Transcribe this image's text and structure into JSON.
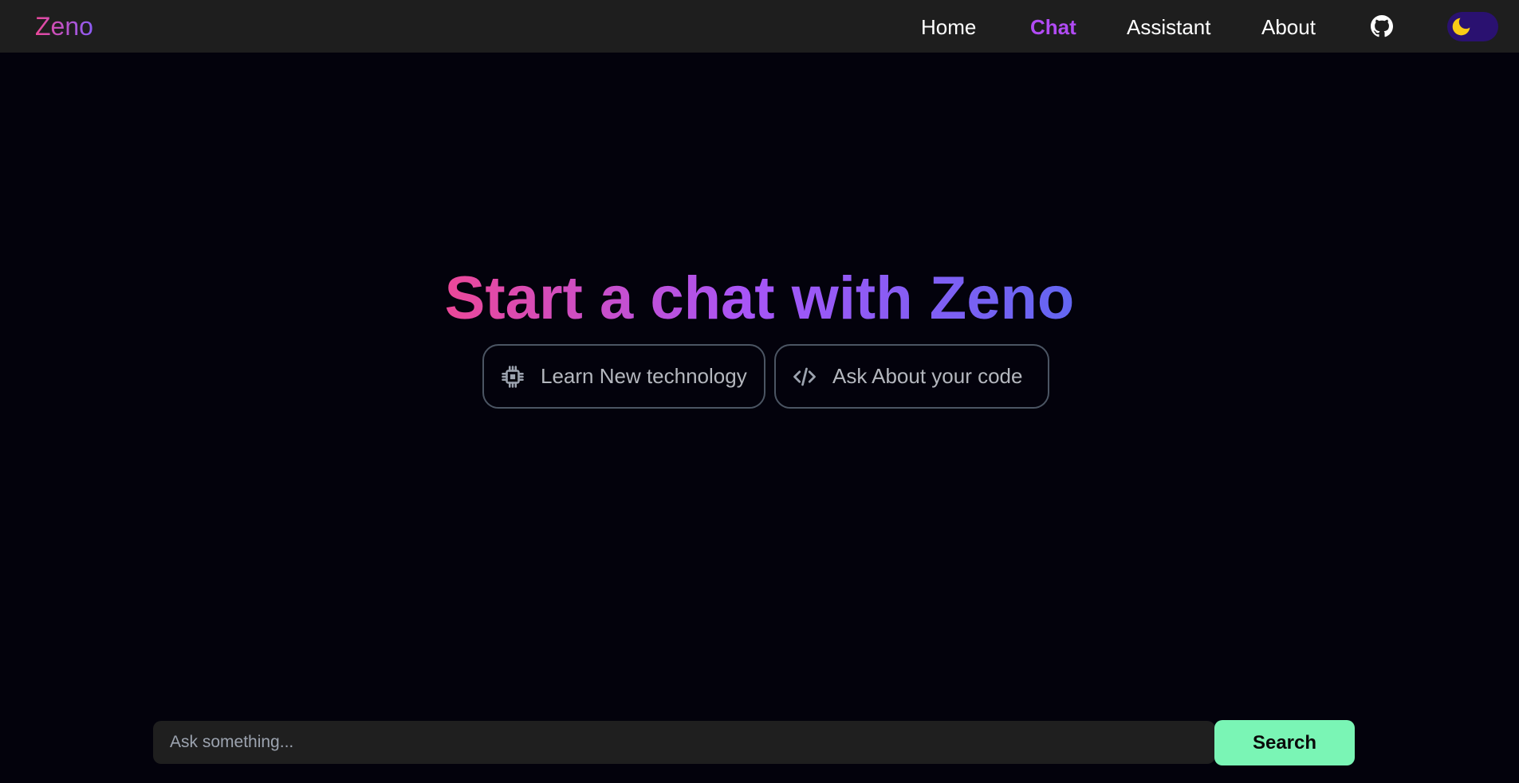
{
  "brand": {
    "name": "Zeno"
  },
  "nav": {
    "items": [
      {
        "label": "Home",
        "active": false
      },
      {
        "label": "Chat",
        "active": true
      },
      {
        "label": "Assistant",
        "active": false
      },
      {
        "label": "About",
        "active": false
      }
    ],
    "github_icon": "github-icon",
    "theme_toggle": {
      "icon": "moon-icon",
      "mode": "dark"
    }
  },
  "hero": {
    "title": "Start a chat with Zeno"
  },
  "suggestions": [
    {
      "icon": "cpu-chip-icon",
      "label": "Learn New technology"
    },
    {
      "icon": "code-icon",
      "label": "Ask About your code"
    }
  ],
  "search": {
    "placeholder": "Ask something...",
    "value": "",
    "button_label": "Search"
  },
  "colors": {
    "background": "#03020c",
    "navbar": "#1e1e1e",
    "active_nav": "#b14bf4",
    "gradient_start": "#ec4899",
    "gradient_mid": "#a855f7",
    "gradient_end": "#6366f1",
    "search_button": "#7af5b5",
    "toggle_track": "#2a1170",
    "moon": "#facc15"
  }
}
